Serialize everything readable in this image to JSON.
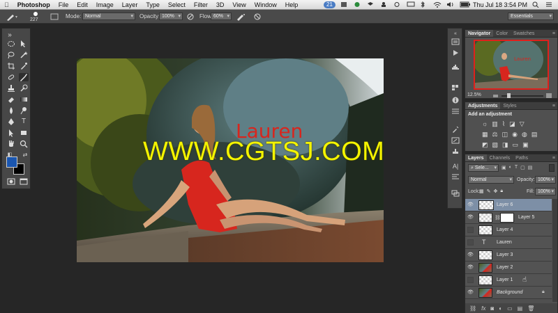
{
  "menubar": {
    "app": "Photoshop",
    "items": [
      "File",
      "Edit",
      "Image",
      "Layer",
      "Type",
      "Select",
      "Filter",
      "3D",
      "View",
      "Window",
      "Help"
    ],
    "badge": "21",
    "clock": "Thu Jul 18  3:54 PM"
  },
  "options": {
    "brush_size": "227",
    "mode_label": "Mode:",
    "mode_value": "Normal",
    "opacity_label": "Opacity:",
    "opacity_value": "100%",
    "flow_label": "Flow:",
    "flow_value": "60%",
    "workspace": "Essentials"
  },
  "canvas": {
    "text_layer": "Lauren"
  },
  "watermark": "WWW.CGTSJ.COM",
  "navigator": {
    "tabs": [
      "Navigator",
      "Color",
      "Swatches"
    ],
    "zoom": "12.5%"
  },
  "adjustments": {
    "tabs": [
      "Adjustments",
      "Styles"
    ],
    "heading": "Add an adjustment"
  },
  "layers": {
    "tabs": [
      "Layers",
      "Channels",
      "Paths"
    ],
    "kind_placeholder": "Sele...",
    "blend_mode": "Normal",
    "opacity_label": "Opacity:",
    "opacity_value": "100%",
    "lock_label": "Lock:",
    "fill_label": "Fill:",
    "fill_value": "100%",
    "rows": [
      {
        "name": "Layer 6"
      },
      {
        "name": "Layer 5"
      },
      {
        "name": "Layer 4"
      },
      {
        "name": "Lauren"
      },
      {
        "name": "Layer 3"
      },
      {
        "name": "Layer 2"
      },
      {
        "name": "Layer 1"
      },
      {
        "name": "Background"
      }
    ]
  }
}
